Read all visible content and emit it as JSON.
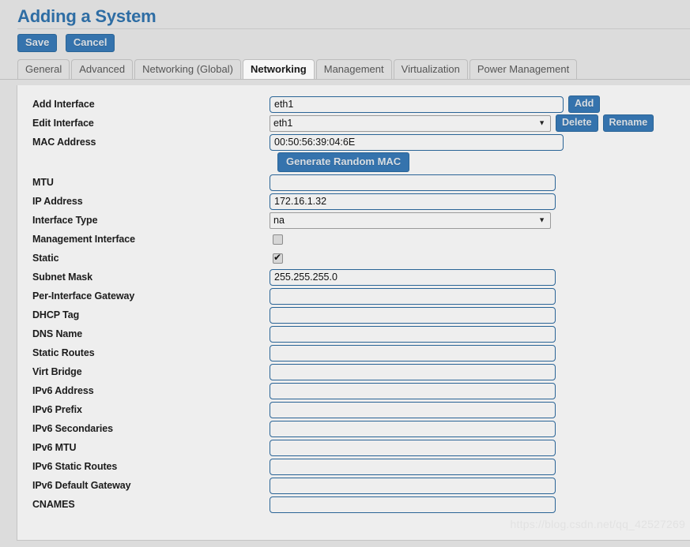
{
  "header": {
    "title": "Adding a System",
    "save_label": "Save",
    "cancel_label": "Cancel"
  },
  "tabs": [
    {
      "label": "General",
      "active": false
    },
    {
      "label": "Advanced",
      "active": false
    },
    {
      "label": "Networking (Global)",
      "active": false
    },
    {
      "label": "Networking",
      "active": true
    },
    {
      "label": "Management",
      "active": false
    },
    {
      "label": "Virtualization",
      "active": false
    },
    {
      "label": "Power Management",
      "active": false
    }
  ],
  "form": {
    "add_interface": {
      "label": "Add Interface",
      "value": "eth1",
      "placeholder": "",
      "button": "Add"
    },
    "edit_interface": {
      "label": "Edit Interface",
      "value": "eth1",
      "options": [
        "eth1"
      ],
      "delete_button": "Delete",
      "rename_button": "Rename"
    },
    "mac_address": {
      "label": "MAC Address",
      "value": "00:50:56:39:04:6E",
      "placeholder": ""
    },
    "generate_mac_button": "Generate Random MAC",
    "fields": [
      {
        "label": "MTU",
        "value": "",
        "type": "text"
      },
      {
        "label": "IP Address",
        "value": "172.16.1.32",
        "type": "text"
      },
      {
        "label": "Interface Type",
        "value": "na",
        "type": "select",
        "options": [
          "na"
        ]
      },
      {
        "label": "Management Interface",
        "value": "",
        "type": "checkbox",
        "checked": false
      },
      {
        "label": "Static",
        "value": "",
        "type": "checkbox",
        "checked": true
      },
      {
        "label": "Subnet Mask",
        "value": "255.255.255.0",
        "type": "text"
      },
      {
        "label": "Per-Interface Gateway",
        "value": "",
        "type": "text"
      },
      {
        "label": "DHCP Tag",
        "value": "",
        "type": "text"
      },
      {
        "label": "DNS Name",
        "value": "",
        "type": "text"
      },
      {
        "label": "Static Routes",
        "value": "",
        "type": "text"
      },
      {
        "label": "Virt Bridge",
        "value": "",
        "type": "text"
      },
      {
        "label": "IPv6 Address",
        "value": "",
        "type": "text"
      },
      {
        "label": "IPv6 Prefix",
        "value": "",
        "type": "text"
      },
      {
        "label": "IPv6 Secondaries",
        "value": "",
        "type": "text"
      },
      {
        "label": "IPv6 MTU",
        "value": "",
        "type": "text"
      },
      {
        "label": "IPv6 Static Routes",
        "value": "",
        "type": "text"
      },
      {
        "label": "IPv6 Default Gateway",
        "value": "",
        "type": "text"
      },
      {
        "label": "CNAMES",
        "value": "",
        "type": "text"
      }
    ]
  },
  "watermark": "https://blog.csdn.net/qq_42527269",
  "colors": {
    "accent": "#2e6da4",
    "button_bg": "#3573ad",
    "input_border": "#2a6496",
    "panel_bg": "#eeeeee",
    "page_bg": "#dcdcdc"
  }
}
